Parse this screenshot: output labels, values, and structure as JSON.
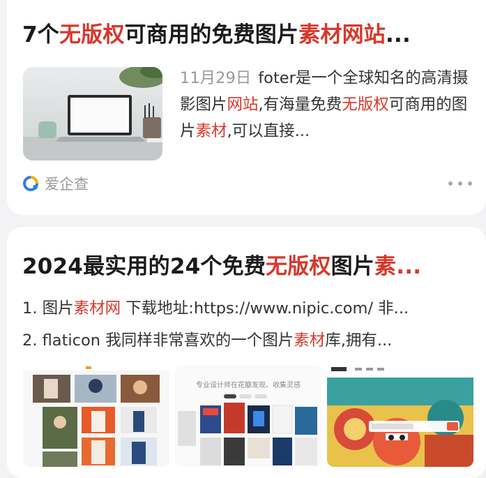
{
  "results": [
    {
      "title_parts": [
        {
          "text": "7个",
          "hl": false
        },
        {
          "text": "无版权",
          "hl": true
        },
        {
          "text": "可商用的免费图片",
          "hl": false
        },
        {
          "text": "素材网站",
          "hl": true
        },
        {
          "text": "...",
          "hl": false
        }
      ],
      "date": "11月29日",
      "snippet_parts": [
        {
          "text": "foter是一个全球知名的高清摄影图片",
          "hl": false
        },
        {
          "text": "网站",
          "hl": true
        },
        {
          "text": ",有海量免费",
          "hl": false
        },
        {
          "text": "无版权",
          "hl": true
        },
        {
          "text": "可商用的图片",
          "hl": false
        },
        {
          "text": "素材",
          "hl": true
        },
        {
          "text": ",可以直接...",
          "hl": false
        }
      ],
      "source_name": "爱企查",
      "source_icon": "aiqicha-logo-icon",
      "more_icon": "more-dots-icon"
    },
    {
      "title_parts": [
        {
          "text": "2024最实用的24个免费",
          "hl": false
        },
        {
          "text": "无版权",
          "hl": true
        },
        {
          "text": "图片",
          "hl": false
        },
        {
          "text": "素...",
          "hl": true
        }
      ],
      "lines": [
        [
          {
            "text": "1. 图片",
            "hl": false
          },
          {
            "text": "素材网",
            "hl": true
          },
          {
            "text": " 下载地址:https://www.nipic.com/ 非...",
            "hl": false
          }
        ],
        [
          {
            "text": "2. flaticon 我同样非常喜欢的一个图片",
            "hl": false
          },
          {
            "text": "素材",
            "hl": true
          },
          {
            "text": "库,拥有...",
            "hl": false
          }
        ]
      ],
      "thumbnails": [
        "photo-grid-screenshot",
        "design-inspiration-screenshot",
        "illustration-site-screenshot"
      ],
      "thumb2_text": "专业设计师在花瓣发现、收集灵感"
    }
  ],
  "colors": {
    "highlight": "#d8372b",
    "muted": "#9a9a9a",
    "card": "#ffffff",
    "page": "#f3f3f5"
  }
}
